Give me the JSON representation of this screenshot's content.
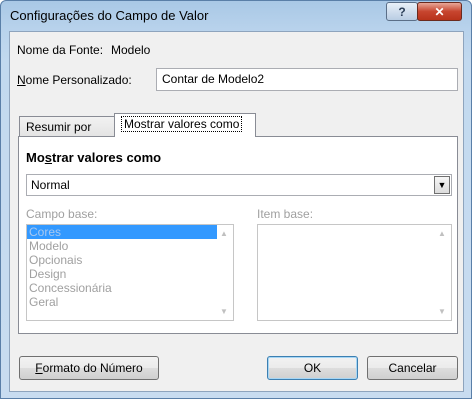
{
  "window": {
    "title": "Configurações do Campo de Valor",
    "help_label": "?",
    "close_label": "✕"
  },
  "source": {
    "label": "Nome da Fonte:",
    "value": "Modelo"
  },
  "custom_name": {
    "label_mnemonic": "N",
    "label_rest": "ome Personalizado:",
    "value": "Contar de Modelo2"
  },
  "tabs": [
    {
      "label": "Resumir por"
    },
    {
      "label": "Mostrar valores como"
    }
  ],
  "show_values": {
    "section_title_pre": "Mo",
    "section_title_mnemonic": "s",
    "section_title_post": "trar valores como",
    "selected_option": "Normal",
    "arrow_icon": "▼"
  },
  "base_field": {
    "label": "Campo base:",
    "items": [
      "Cores",
      "Modelo",
      "Opcionais",
      "Design",
      "Concessionária",
      "Geral"
    ],
    "selected_index": 0
  },
  "base_item": {
    "label": "Item base:"
  },
  "scroll": {
    "up_icon": "▲",
    "down_icon": "▼"
  },
  "buttons": {
    "number_format_mnemonic": "F",
    "number_format_rest": "ormato do Número",
    "ok": "OK",
    "cancel": "Cancelar"
  }
}
